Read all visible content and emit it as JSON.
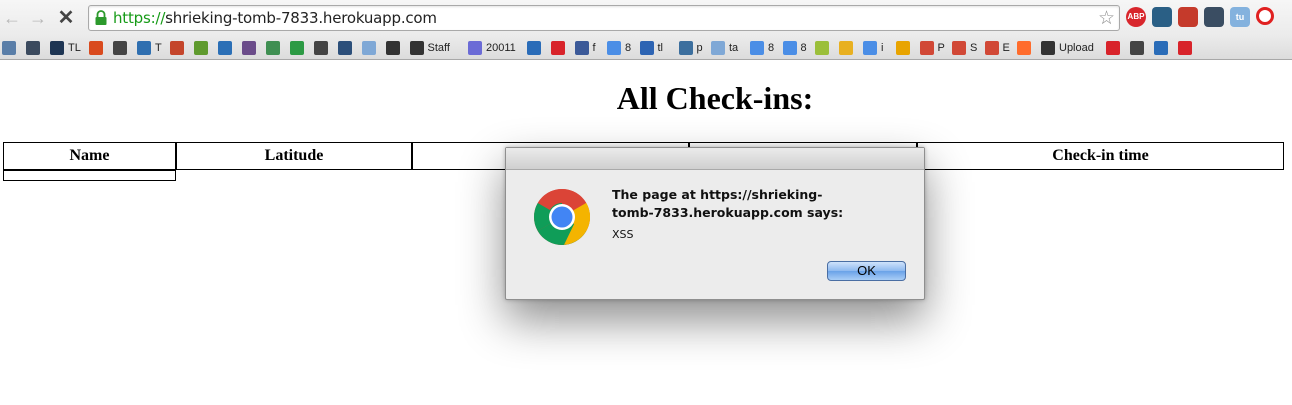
{
  "browser": {
    "url_scheme": "https://",
    "url_host": "shrieking-tomb-7833.herokuapp.com",
    "extensions": [
      {
        "label": "ABP",
        "icon": "adblock-plus-icon"
      },
      {
        "label": "",
        "icon": "extension-icon"
      },
      {
        "label": "",
        "icon": "extension-icon"
      },
      {
        "label": "",
        "icon": "extension-icon"
      },
      {
        "label": "tu",
        "icon": "extension-icon"
      },
      {
        "label": "",
        "icon": "extension-icon"
      }
    ],
    "bookmarks": [
      {
        "label": "",
        "icon": "bookmark-icon",
        "color": "#5a7ea8"
      },
      {
        "label": "",
        "icon": "bookmark-icon",
        "color": "#3b4a5e"
      },
      {
        "label": "TL",
        "icon": "bookmark-icon",
        "color": "#1e3553"
      },
      {
        "label": "",
        "icon": "bookmark-icon",
        "color": "#d94a1e"
      },
      {
        "label": "",
        "icon": "bookmark-icon",
        "color": "#444444"
      },
      {
        "label": "T",
        "icon": "bookmark-icon",
        "color": "#2f6fb0"
      },
      {
        "label": "",
        "icon": "bookmark-icon",
        "color": "#c4452b"
      },
      {
        "label": "",
        "icon": "bookmark-icon",
        "color": "#5f9a2e"
      },
      {
        "label": "",
        "icon": "bookmark-icon",
        "color": "#2b6fb6"
      },
      {
        "label": "",
        "icon": "bookmark-icon",
        "color": "#6b4c8a"
      },
      {
        "label": "",
        "icon": "bookmark-icon",
        "color": "#3f8f52"
      },
      {
        "label": "",
        "icon": "bookmark-icon",
        "color": "#2c9a44"
      },
      {
        "label": "",
        "icon": "bookmark-icon",
        "color": "#444444"
      },
      {
        "label": "",
        "icon": "bookmark-icon",
        "color": "#2c4f7a"
      },
      {
        "label": "",
        "icon": "folder-icon",
        "color": "#7fa8d6"
      },
      {
        "label": "",
        "icon": "bookmark-icon",
        "color": "#333333"
      },
      {
        "label": "Staff",
        "icon": "bookmark-icon",
        "color": "#333333"
      },
      {
        "label": "20011",
        "icon": "bookmark-icon",
        "color": "#6b6bd6"
      },
      {
        "label": "",
        "icon": "bookmark-icon",
        "color": "#2a6cb8"
      },
      {
        "label": "",
        "icon": "youtube-icon",
        "color": "#d8232a"
      },
      {
        "label": "f",
        "icon": "facebook-icon",
        "color": "#3b5998"
      },
      {
        "label": "8",
        "icon": "bookmark-icon",
        "color": "#4b8ee6"
      },
      {
        "label": "tl",
        "icon": "bookmark-icon",
        "color": "#2d64b3"
      },
      {
        "label": "p",
        "icon": "bookmark-icon",
        "color": "#3c6f9e"
      },
      {
        "label": "ta",
        "icon": "folder-icon",
        "color": "#7fa8d6"
      },
      {
        "label": "8",
        "icon": "bookmark-icon",
        "color": "#4b8ee6"
      },
      {
        "label": "8",
        "icon": "bookmark-icon",
        "color": "#4b8ee6"
      },
      {
        "label": "",
        "icon": "bookmark-icon",
        "color": "#9bbf3a"
      },
      {
        "label": "",
        "icon": "bookmark-icon",
        "color": "#e8b020"
      },
      {
        "label": "i",
        "icon": "bookmark-icon",
        "color": "#4b8ee6"
      },
      {
        "label": "",
        "icon": "bookmark-icon",
        "color": "#e8a400"
      },
      {
        "label": "P",
        "icon": "gmail-icon",
        "color": "#d14836"
      },
      {
        "label": "S",
        "icon": "gmail-icon",
        "color": "#d14836"
      },
      {
        "label": "E",
        "icon": "gmail-icon",
        "color": "#d14836"
      },
      {
        "label": "",
        "icon": "cpanel-icon",
        "color": "#ff6c2c"
      },
      {
        "label": "Upload",
        "icon": "bookmark-icon",
        "color": "#333333"
      },
      {
        "label": "",
        "icon": "bookmark-icon",
        "color": "#d8232a"
      },
      {
        "label": "",
        "icon": "bookmark-icon",
        "color": "#444444"
      },
      {
        "label": "",
        "icon": "bookmark-icon",
        "color": "#2a6cb8"
      },
      {
        "label": "",
        "icon": "bookmark-icon",
        "color": "#d8232a"
      }
    ]
  },
  "page": {
    "title": "All Check-ins:",
    "table": {
      "headers": [
        "Name",
        "Latitude",
        "",
        "",
        "Check-in time"
      ]
    }
  },
  "dialog": {
    "heading": "The page at https://shrieking-tomb-7833.herokuapp.com says:",
    "message": "XSS",
    "ok_label": "OK"
  }
}
